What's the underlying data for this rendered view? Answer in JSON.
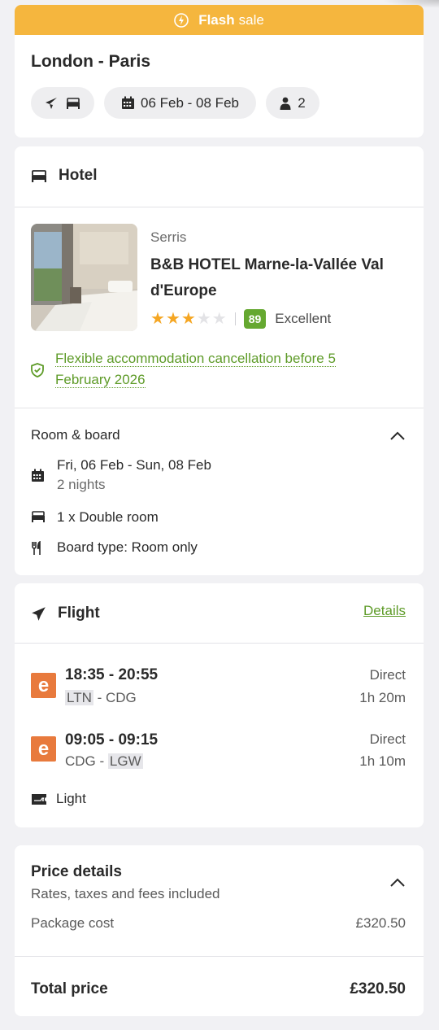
{
  "banner": {
    "bold": "Flash",
    "text": "sale"
  },
  "trip": {
    "route": "London - Paris",
    "dates": "06 Feb - 08 Feb",
    "travellers": "2"
  },
  "hotel": {
    "section_title": "Hotel",
    "location": "Serris",
    "name": "B&B HOTEL Marne-la-Vallée Val d'Europe",
    "stars": 3,
    "max_stars": 5,
    "score": "89",
    "score_label": "Excellent",
    "cancellation": "Flexible accommodation cancellation before 5 February 2026",
    "room_board_title": "Room & board",
    "stay_dates": "Fri, 06 Feb - Sun, 08 Feb",
    "nights": "2 nights",
    "room": "1 x Double room",
    "board": "Board type: Room only"
  },
  "flight": {
    "section_title": "Flight",
    "details_link": "Details",
    "airline_logo_letter": "e",
    "legs": [
      {
        "time": "18:35 - 20:55",
        "from": "LTN",
        "to": "CDG",
        "type": "Direct",
        "duration": "1h 20m"
      },
      {
        "time": "09:05 - 09:15",
        "from": "CDG",
        "to": "LGW",
        "type": "Direct",
        "duration": "1h 10m"
      }
    ],
    "fare": "Light"
  },
  "price": {
    "title": "Price details",
    "subtitle": "Rates, taxes and fees included",
    "package_label": "Package cost",
    "package_value": "£320.50",
    "total_label": "Total price",
    "total_value": "£320.50"
  },
  "colors": {
    "banner": "#f5b63e",
    "accent_green": "#5e9b28",
    "score_badge": "#65a830",
    "star": "#f5a623",
    "airline": "#e87a3d"
  },
  "icons": {
    "banner": "lightning-tag-icon",
    "trip_type": [
      "plane-icon",
      "bed-icon"
    ],
    "dates": "calendar-icon",
    "travellers": "person-icon",
    "hotel": "bed-icon",
    "cancellation": "shield-check-icon",
    "collapse": "chevron-up-icon",
    "flight": "plane-icon",
    "fare": "luggage-ticket-icon",
    "board": "cutlery-icon"
  }
}
